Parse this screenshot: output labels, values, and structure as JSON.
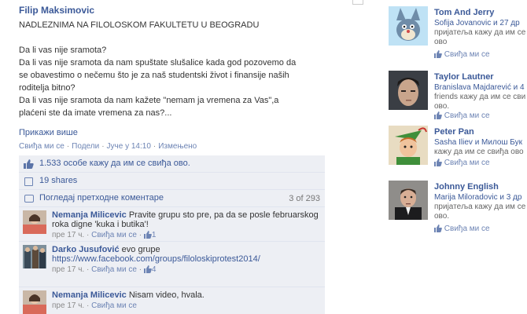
{
  "post": {
    "author": "Filip Maksimovic",
    "lines": [
      "NADLEZNIMA NA FILOLOSKOM FAKULTETU U BEOGRADU",
      "",
      "Da li vas nije sramota?",
      "Da li vas nije sramota da nam spuštate slušalice kada god pozovemo da",
      "se obavestimo o nečemu što je za naš studentski život i finansije naših",
      "roditelja bitno?",
      "Da li vas nije sramota da nam kažete \"nemam ja vremena za Vas\",a",
      "plaćeni ste da imate vremena za nas?..."
    ],
    "show_more": "Прикажи више",
    "meta": {
      "like": "Свиђа ми се",
      "share": "Подели",
      "time": "Јуче у 14:10",
      "edited": "Измењено"
    },
    "likes_text": "1.533 особе кажу да им се свиђа ово.",
    "shares_text": "19 shares",
    "previous_comments": "Погледај претходне коментаре",
    "comment_count": "3 of 293",
    "comments": [
      {
        "name": "Nemanja Milicevic",
        "text": "Pravite grupu sto pre, pa da se posle februarskog roka digne 'kuka i butika'!",
        "time": "пре 17 ч.",
        "like": "Свиђа ми се",
        "likes": "1"
      },
      {
        "name": "Darko Jusufović",
        "text": "evo grupe",
        "link": "https://www.facebook.com/groups/filoloskiprotest2014/",
        "time": "пре 17 ч.",
        "like": "Свиђа ми се",
        "likes": "4"
      },
      {
        "name": "Nemanja Milicevic",
        "text": "Nisam video, hvala.",
        "time": "пре 17 ч.",
        "like": "Свиђа ми се",
        "likes": ""
      }
    ]
  },
  "sidebar": {
    "pages": [
      {
        "name": "Tom And Jerry",
        "desc_1": "Sofija Jovanovic и 27 др",
        "desc_2": "пријатеља кажу да им се",
        "desc_3": "ово",
        "like": "Свиђа ми се",
        "icon": "tom-and-jerry-picture"
      },
      {
        "name": "Taylor Lautner",
        "desc_1": "Branislava Majdarević и 4",
        "desc_2": "friends кажу да им се сви",
        "desc_3": "ово.",
        "like": "Свиђа ми се",
        "icon": "taylor-lautner-picture"
      },
      {
        "name": "Peter Pan",
        "desc_1": "Sasha Iliev и Милош Бук",
        "desc_2": "кажу да им се свиђа ово",
        "desc_3": "",
        "like": "Свиђа ми се",
        "icon": "peter-pan-picture"
      },
      {
        "name": "Johnny English",
        "desc_1": "Marija Miloradovic и 3 др",
        "desc_2": "пријатеља кажу да им се",
        "desc_3": "ово.",
        "like": "Свиђа ми се",
        "icon": "johnny-english-picture"
      }
    ]
  },
  "colors": {
    "link": "#3b5998",
    "panel": "#edeff4",
    "meta": "#8a8a8a"
  }
}
